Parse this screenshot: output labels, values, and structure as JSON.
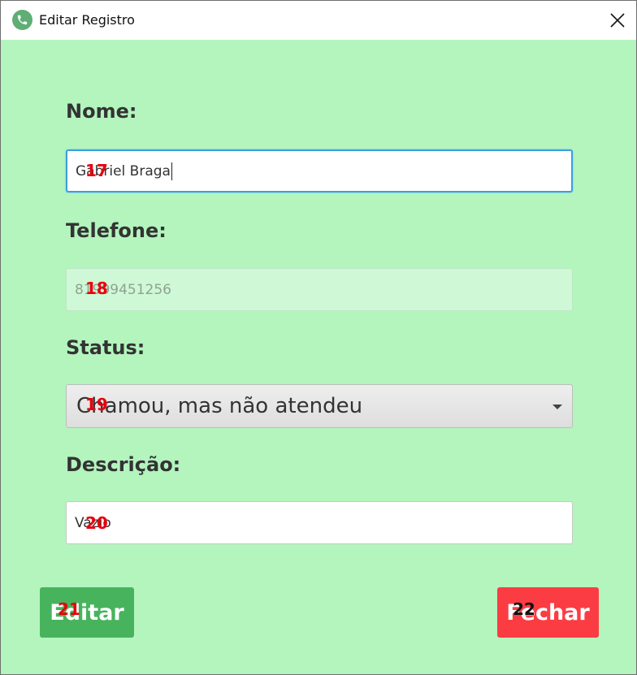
{
  "window": {
    "title": "Editar Registro"
  },
  "icons": {
    "app": "phone-icon",
    "close": "close-icon",
    "dropdown": "chevron-down-icon"
  },
  "form": {
    "nome_label": "Nome:",
    "nome_value": "Gabriel Braga",
    "telefone_label": "Telefone:",
    "telefone_value": "81999451256",
    "status_label": "Status:",
    "status_value": "Chamou, mas não atendeu",
    "descricao_label": "Descrição:",
    "descricao_value": "Vazio"
  },
  "buttons": {
    "edit_label": "Editar",
    "close_label": "Fechar"
  },
  "markers": {
    "m17": "17",
    "m18": "18",
    "m19": "19",
    "m20": "20",
    "m21": "21",
    "m22": "22"
  },
  "colors": {
    "background": "#b3f5bd",
    "edit_button": "#47b45d",
    "close_button": "#fc3c43",
    "focus_border": "#3d9ede"
  }
}
